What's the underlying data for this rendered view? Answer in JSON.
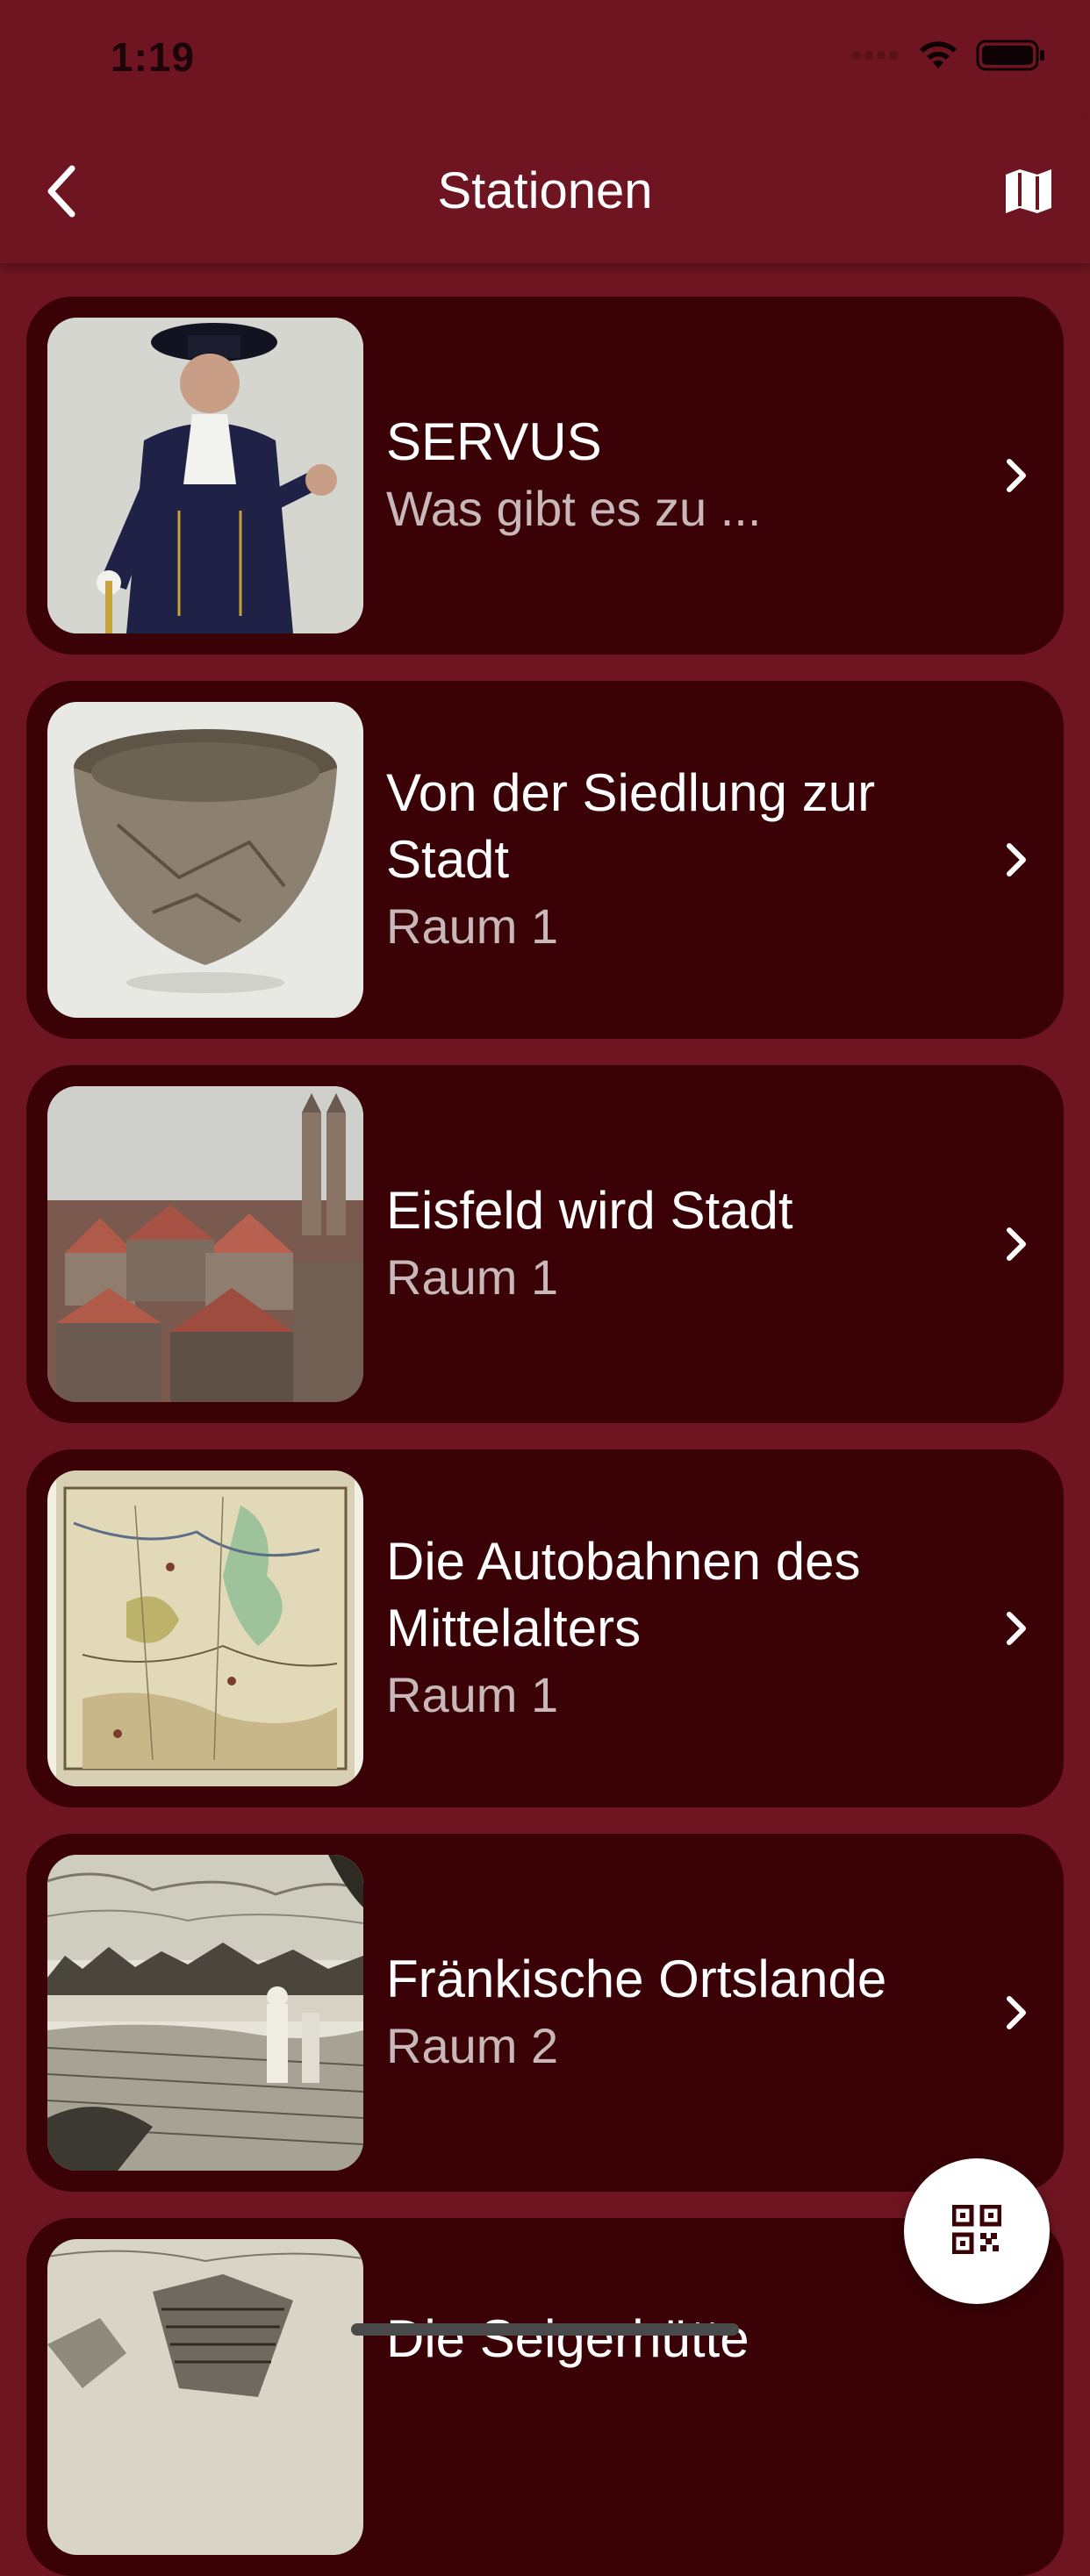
{
  "status_bar": {
    "time": "1:19"
  },
  "nav": {
    "title": "Stationen",
    "back_icon": "chevron-left-icon",
    "map_icon": "map-icon"
  },
  "stations": [
    {
      "title": "SERVUS",
      "subtitle": "Was gibt es zu ..."
    },
    {
      "title": "Von der Siedlung zur Stadt",
      "subtitle": "Raum 1"
    },
    {
      "title": "Eisfeld wird Stadt",
      "subtitle": "Raum 1"
    },
    {
      "title": "Die Autobahnen des Mittelalters",
      "subtitle": "Raum 1"
    },
    {
      "title": "Fränkische Ortslande",
      "subtitle": "Raum 2"
    },
    {
      "title": "Die Seigerhütte",
      "subtitle": ""
    }
  ],
  "fab": {
    "icon": "qr-code-icon"
  },
  "colors": {
    "background": "#6e1521",
    "card": "#3a0206",
    "subtitle": "#c9b8ba"
  }
}
